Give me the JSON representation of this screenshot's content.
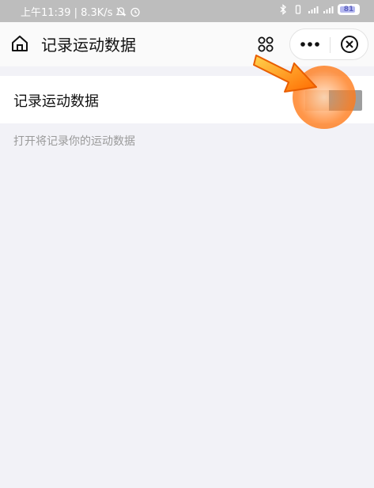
{
  "status_bar": {
    "time_speed": "上午11:39 | 8.3K/s",
    "battery": "81"
  },
  "nav": {
    "title": "记录运动数据"
  },
  "setting": {
    "label": "记录运动数据",
    "toggle_on": false,
    "description": "打开将记录你的运动数据"
  },
  "colors": {
    "accent_arrow": "#ff8a1e",
    "toggle_off": "#9e9e9e",
    "page_bg": "#f2f2f7"
  }
}
